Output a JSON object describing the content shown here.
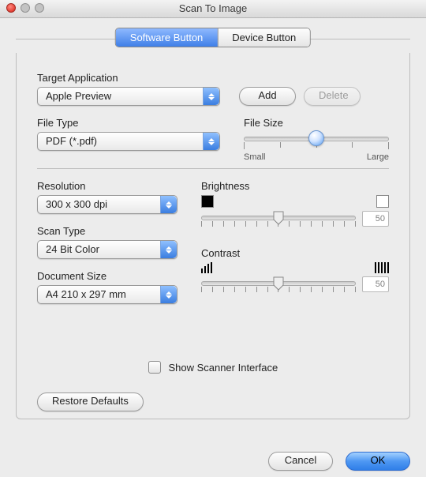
{
  "window": {
    "title": "Scan To Image"
  },
  "tabs": {
    "software": "Software Button",
    "device": "Device Button"
  },
  "labels": {
    "target_app": "Target Application",
    "file_type": "File Type",
    "file_size": "File Size",
    "resolution": "Resolution",
    "scan_type": "Scan Type",
    "document_size": "Document Size",
    "brightness": "Brightness",
    "contrast": "Contrast",
    "show_scanner": "Show Scanner Interface"
  },
  "values": {
    "target_app": "Apple Preview",
    "file_type": "PDF (*.pdf)",
    "resolution": "300 x 300 dpi",
    "scan_type": "24 Bit Color",
    "document_size": "A4  210 x 297 mm",
    "brightness": "50",
    "contrast": "50"
  },
  "file_size_scale": {
    "small": "Small",
    "large": "Large"
  },
  "buttons": {
    "add": "Add",
    "delete": "Delete",
    "restore": "Restore Defaults",
    "cancel": "Cancel",
    "ok": "OK"
  },
  "checkbox": {
    "show_scanner_checked": false
  }
}
